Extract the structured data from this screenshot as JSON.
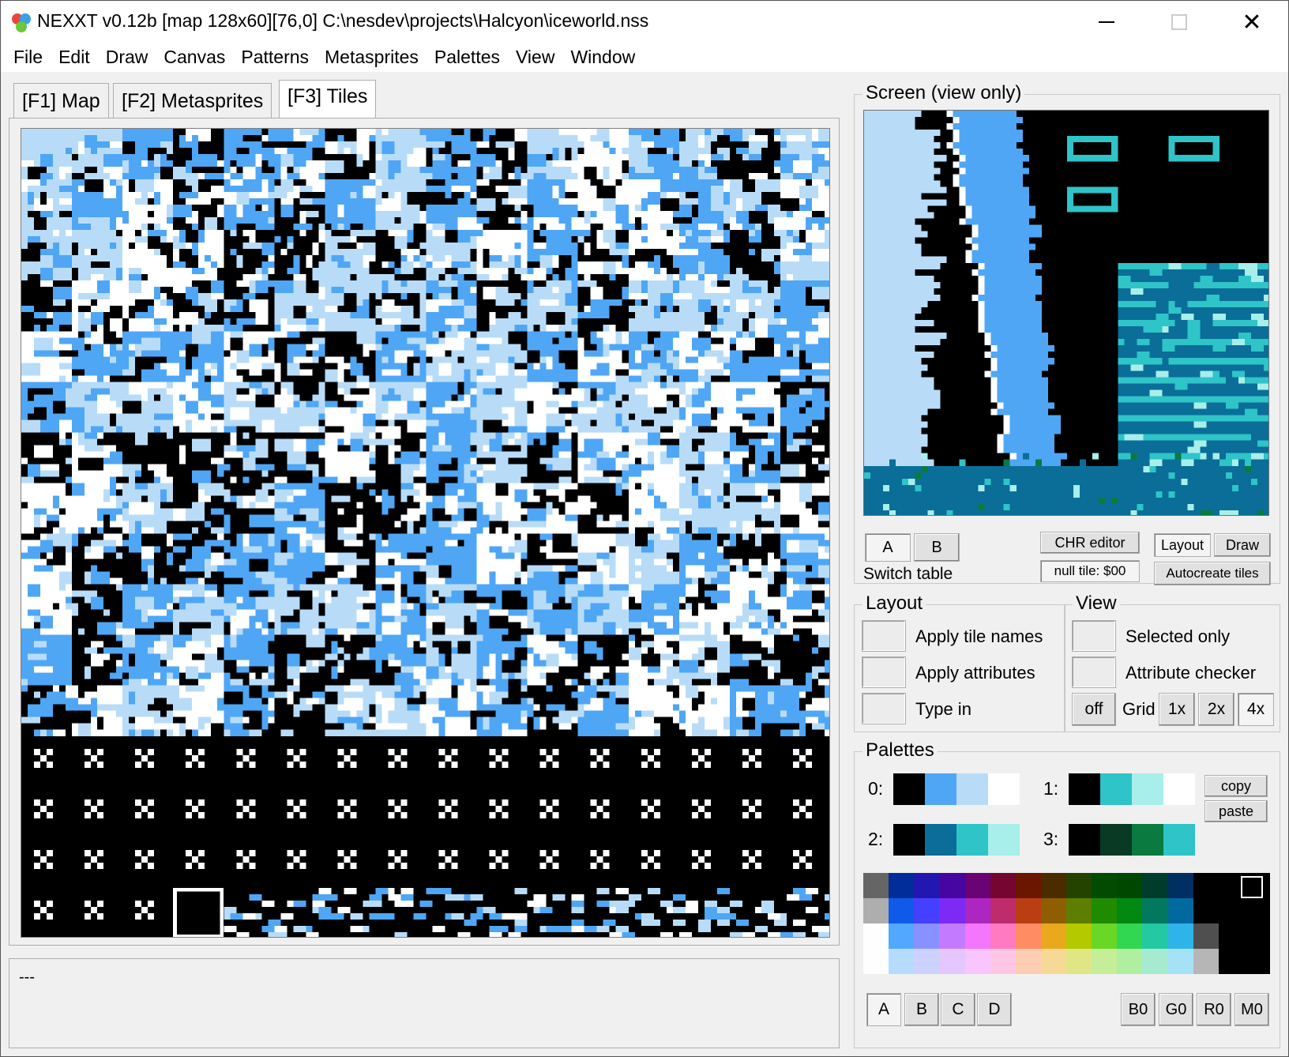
{
  "window": {
    "title": "NEXXT v0.12b  [map 128x60][76,0] C:\\nesdev\\projects\\Halcyon\\iceworld.nss",
    "minimize_glyph": "",
    "close_glyph": "✕"
  },
  "menu": [
    "File",
    "Edit",
    "Draw",
    "Canvas",
    "Patterns",
    "Metasprites",
    "Palettes",
    "View",
    "Window"
  ],
  "tabs": [
    {
      "label": "[F1] Map",
      "active": false
    },
    {
      "label": "[F2] Metasprites",
      "active": false
    },
    {
      "label": "[F3] Tiles",
      "active": true
    }
  ],
  "status_text": "---",
  "screen": {
    "title": "Screen (view only)",
    "table_a": "A",
    "table_b": "B",
    "switch_table": "Switch table",
    "chr_editor": "CHR editor",
    "null_tile": "null tile: $00",
    "layout_btn": "Layout",
    "draw_btn": "Draw",
    "autocreate": "Autocreate tiles"
  },
  "layout_group": {
    "title": "Layout",
    "apply_tile_names": "Apply tile names",
    "apply_attributes": "Apply attributes",
    "type_in": "Type in"
  },
  "view_group": {
    "title": "View",
    "selected_only": "Selected only",
    "attribute_checker": "Attribute checker",
    "grid_off": "off",
    "grid_label": "Grid",
    "grid_1x": "1x",
    "grid_2x": "2x",
    "grid_4x": "4x",
    "grid_selected": "4x"
  },
  "palettes": {
    "title": "Palettes",
    "rows": [
      {
        "label": "0:",
        "colors": [
          "#000000",
          "#4fa6f5",
          "#b8dcf8",
          "#ffffff"
        ]
      },
      {
        "label": "1:",
        "colors": [
          "#000000",
          "#2ec4c8",
          "#a8eeea",
          "#ffffff"
        ]
      },
      {
        "label": "2:",
        "colors": [
          "#000000",
          "#0a6e98",
          "#2ec4c8",
          "#a8eeea"
        ]
      },
      {
        "label": "3:",
        "colors": [
          "#000000",
          "#083a24",
          "#0a7a40",
          "#2ec4c8"
        ]
      }
    ],
    "copy": "copy",
    "paste": "paste",
    "sets": [
      "A",
      "B",
      "C",
      "D"
    ],
    "sets_selected": "A",
    "emphasis": [
      "B0",
      "G0",
      "R0",
      "M0"
    ]
  },
  "nes_master_palette": [
    [
      "#656565",
      "#002d99",
      "#2217b0",
      "#46069f",
      "#6a0373",
      "#740630",
      "#6b1700",
      "#4a2c00",
      "#244200",
      "#024b00",
      "#004800",
      "#003c2b",
      "#002f62",
      "#000000",
      "#000000",
      "#000000"
    ],
    [
      "#aeaeae",
      "#0f5ae8",
      "#4540ff",
      "#7d2bf4",
      "#ac26c2",
      "#bf2c6c",
      "#b93f12",
      "#8f5e00",
      "#5d7e00",
      "#1f8b00",
      "#008811",
      "#00795e",
      "#006a9f",
      "#000000",
      "#000000",
      "#000000"
    ],
    [
      "#fefefe",
      "#52a8ff",
      "#8891ff",
      "#c47aff",
      "#f476ff",
      "#ff7ac0",
      "#ff8c63",
      "#e9a91e",
      "#b4c900",
      "#6ad726",
      "#32d751",
      "#24c8a2",
      "#2fb4e9",
      "#4f4f4f",
      "#000000",
      "#000000"
    ],
    [
      "#fefefe",
      "#b5dcff",
      "#ccd2ff",
      "#e4c7ff",
      "#f8c5ff",
      "#ffc6e4",
      "#ffcdb1",
      "#f6d996",
      "#e0e685",
      "#c4ee97",
      "#afef9f",
      "#a6ead0",
      "#a6e2f6",
      "#b6b6b6",
      "#000000",
      "#000000"
    ]
  ]
}
